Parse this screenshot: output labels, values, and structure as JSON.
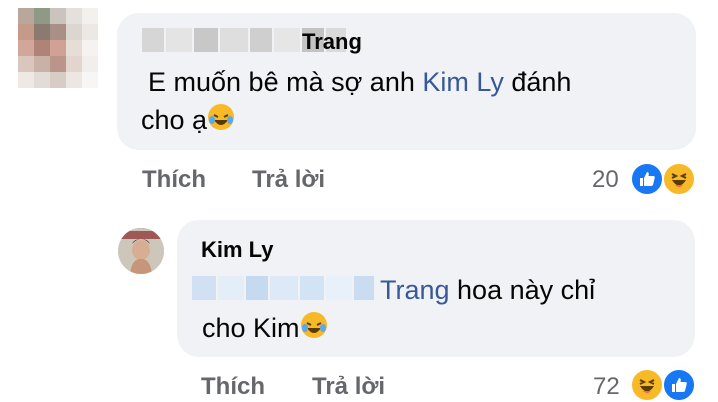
{
  "colors": {
    "bubble": "#f0f2f5",
    "mention": "#385898",
    "action": "#65676b",
    "like": "#1877f2",
    "haha": "#f7b928"
  },
  "comment": {
    "author": "Trang",
    "text_before": "E muốn bê mà sợ anh ",
    "mention": "Kim Ly",
    "text_after": " đánh",
    "text_line2": "cho ạ",
    "inline_emoji": "laughing-tears-icon",
    "actions": {
      "like": "Thích",
      "reply": "Trả lời"
    },
    "reaction_count": "20",
    "reactions": [
      "like-icon",
      "haha-icon"
    ]
  },
  "reply": {
    "author": "Kim Ly",
    "mention": "Trang",
    "text_after": " hoa này chỉ",
    "text_line2": "cho Kim",
    "inline_emoji": "laughing-tears-icon",
    "actions": {
      "like": "Thích",
      "reply": "Trả lời"
    },
    "reaction_count": "72",
    "reactions": [
      "haha-icon",
      "like-icon"
    ]
  }
}
